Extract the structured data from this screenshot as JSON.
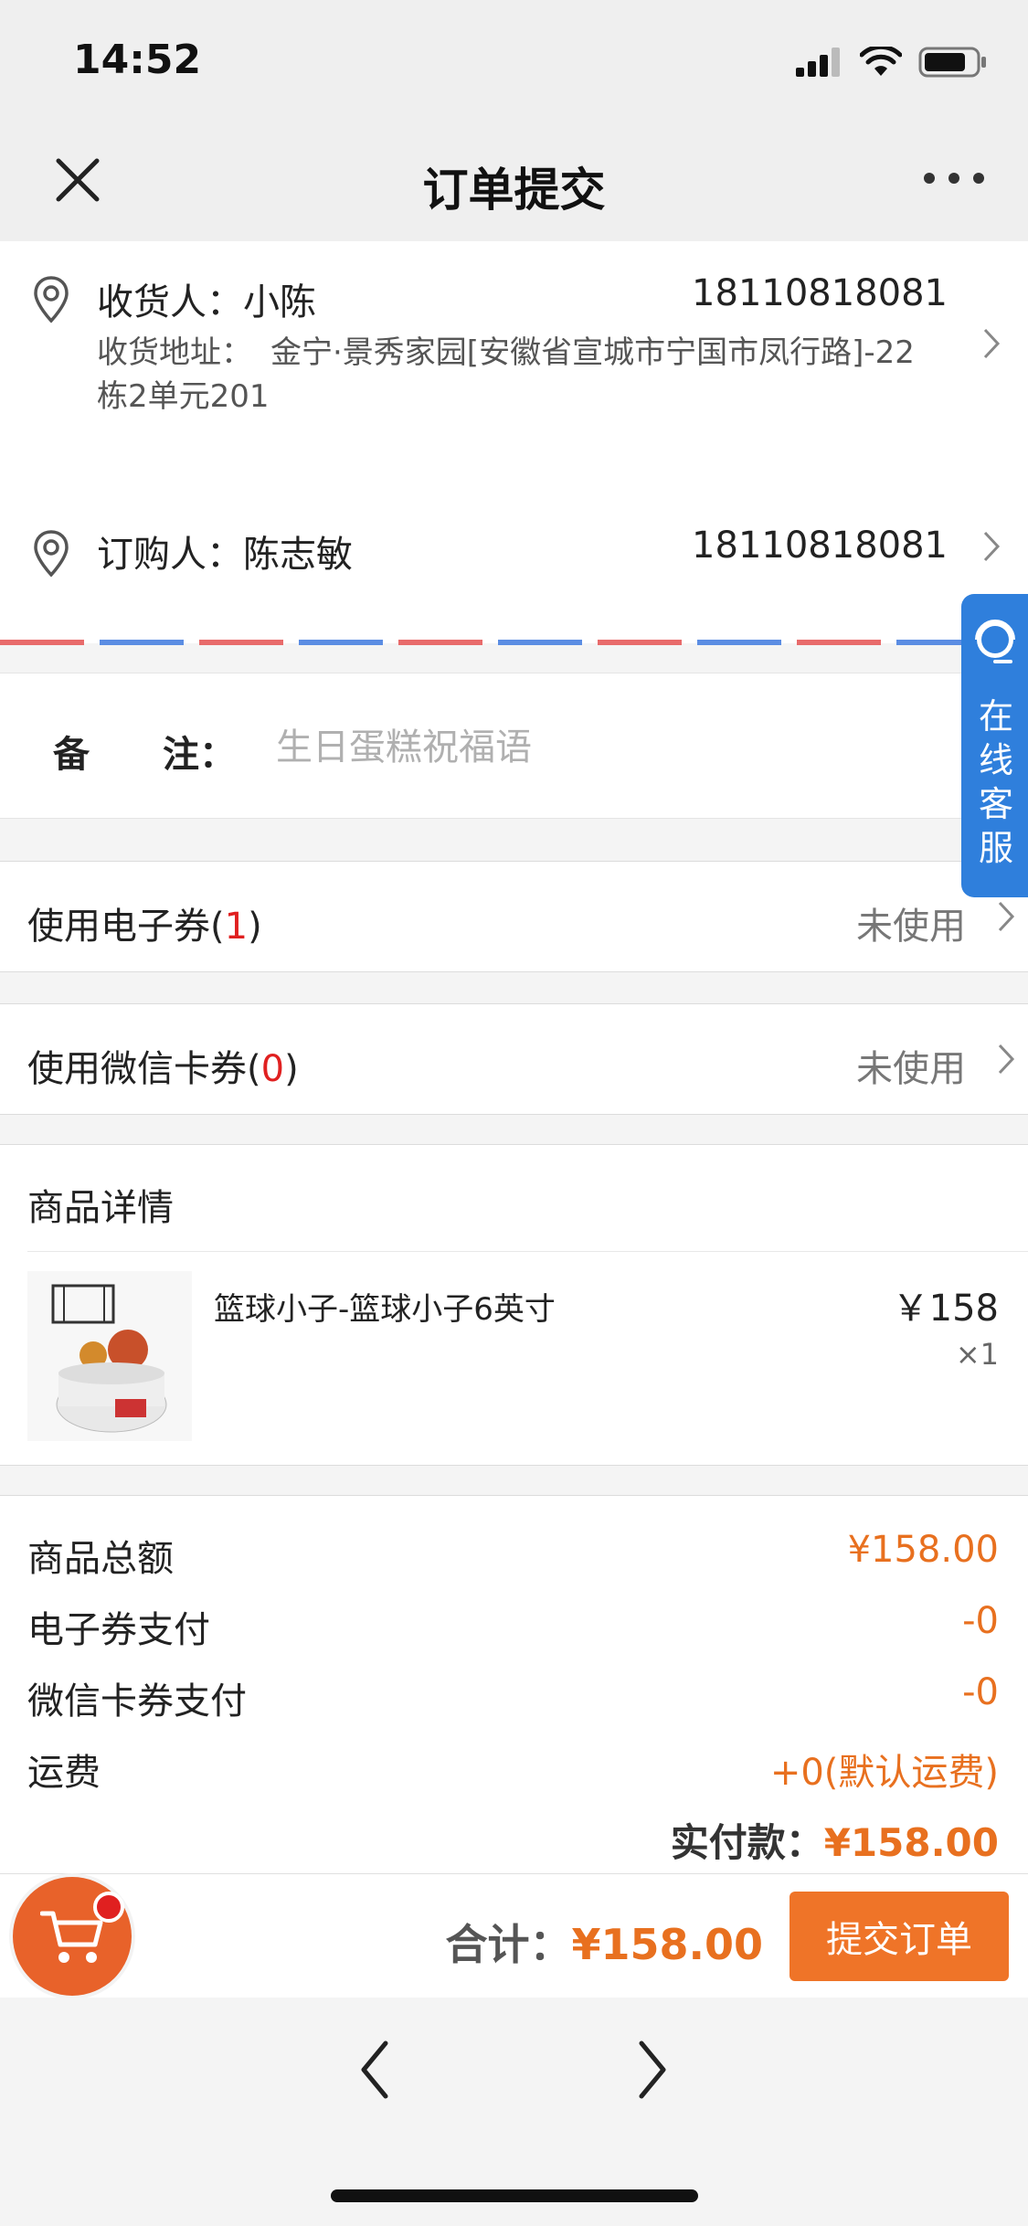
{
  "status": {
    "time": "14:52"
  },
  "nav": {
    "title": "订单提交",
    "close_icon": "close-icon",
    "more_icon": "more-icon"
  },
  "receiver": {
    "label": "收货人：小陈",
    "phone": "18110818081",
    "address_label": "收货地址：",
    "address_line1": "金宁·景秀家园[安徽省宣城市宁国市凤行路]-22",
    "address_line2": "栋2单元201"
  },
  "orderer": {
    "label": "订购人：陈志敏",
    "phone": "18110818081"
  },
  "remark": {
    "label": "备　　注：",
    "placeholder": "生日蛋糕祝福语"
  },
  "coupon": {
    "label": "使用电子券(",
    "count": "1",
    "close": ")",
    "value": "未使用"
  },
  "wechat_card": {
    "label": "使用微信卡券(",
    "count": "0",
    "close": ")",
    "value": "未使用"
  },
  "goods": {
    "title": "商品详情",
    "items": [
      {
        "name": "篮球小子-篮球小子6英寸",
        "price": "￥158",
        "qty": "×1"
      }
    ]
  },
  "summary": {
    "rows": [
      {
        "label": "商品总额",
        "value": "¥158.00"
      },
      {
        "label": "电子券支付",
        "value": "-0"
      },
      {
        "label": "微信卡券支付",
        "value": "-0"
      },
      {
        "label": "运费",
        "value": "+0(默认运费)"
      }
    ],
    "paid_label": "实付款：",
    "paid_value": "¥158.00"
  },
  "footer": {
    "total_label": "合计：",
    "total_value": "¥158.00",
    "submit_label": "提交订单"
  },
  "service": {
    "label": "在线客服"
  },
  "colors": {
    "accent": "#ef7428",
    "red": "#e02020",
    "service": "#2f7fdc"
  }
}
